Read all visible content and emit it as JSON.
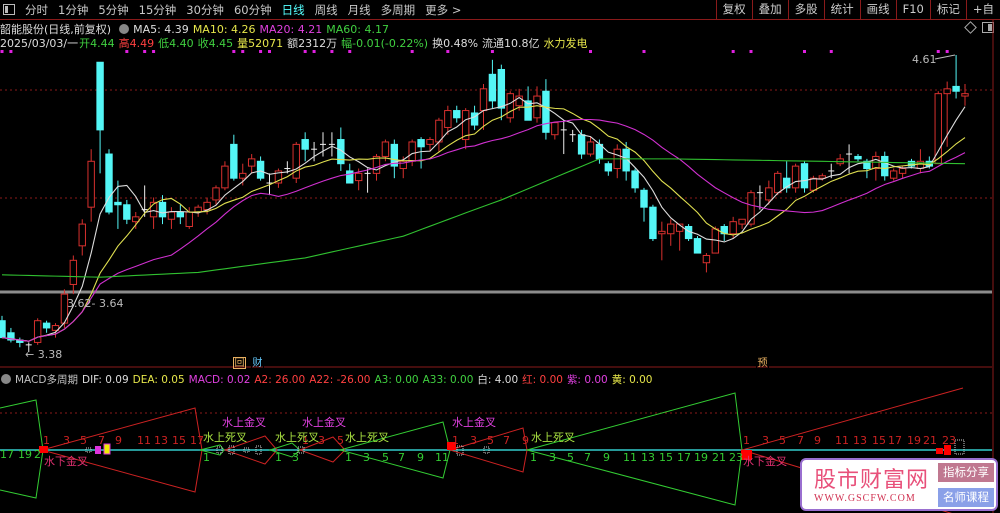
{
  "toolbar": {
    "periods": [
      "分时",
      "1分钟",
      "5分钟",
      "15分钟",
      "30分钟",
      "60分钟",
      "日线",
      "周线",
      "月线",
      "多周期",
      "更多 >"
    ],
    "active_period": "日线",
    "buttons": [
      "复权",
      "叠加",
      "多股",
      "统计",
      "画线",
      "F10",
      "标记",
      "+自"
    ]
  },
  "header": {
    "title": "韶能股份(日线,前复权)",
    "ma5": "MA5: 4.39",
    "ma10": "MA10: 4.26",
    "ma20": "MA20: 4.21",
    "ma60": "MA60: 4.17",
    "date": "2025/03/03/一",
    "open": "开4.44",
    "high": "高4.49",
    "low": "低4.40",
    "close": "收4.45",
    "volume": "量52071",
    "amount": "额2312万",
    "change": "幅-0.01(-0.22%)",
    "turnover": "换0.48%",
    "float": "流通10.8亿",
    "sector": "水力发电"
  },
  "price_labels": {
    "range": "3.62- 3.64",
    "low": "3.38",
    "high": "4.61"
  },
  "event_marks": {
    "hui": "回",
    "cai": "财",
    "yu": "预"
  },
  "macd": {
    "title": "MACD多周期",
    "dif": "DIF: 0.09",
    "dea": "DEA: 0.05",
    "macd": "MACD: 0.02",
    "a2": "A2: 26.00",
    "a22": "A22: -26.00",
    "a3": "A3: 0.00",
    "a33": "A33: 0.00",
    "bai": "白: 4.00",
    "hong": "红: 0.00",
    "zi": "紫: 0.00",
    "huang": "黄: 0.00",
    "signals": {
      "under_gold": "水下金叉",
      "above_dead": "水上死叉",
      "above_gold": "水上金叉"
    },
    "count_rows": [
      [
        "17",
        "19",
        "2"
      ],
      [
        "1",
        "3",
        "5",
        "7",
        "9",
        "11",
        "13",
        "15",
        "17"
      ],
      [
        "1"
      ],
      [
        "1",
        "3"
      ],
      [
        "1",
        "3",
        "5"
      ],
      [
        "1",
        "3",
        "5",
        "7",
        "9",
        "11"
      ],
      [
        "1",
        "3",
        "5",
        "7",
        "9"
      ],
      [
        "1",
        "3",
        "5",
        "7",
        "9",
        "11",
        "13",
        "15",
        "17",
        "19",
        "21",
        "23"
      ],
      [
        "1",
        "3",
        "5",
        "7",
        "9",
        "11",
        "13",
        "15",
        "17",
        "19",
        "21",
        "23"
      ]
    ]
  },
  "watermark": {
    "name": "股市财富网",
    "url": "WWW.GSCFW.COM",
    "tag1": "指标分享",
    "tag2": "名师课程"
  },
  "colors": {
    "up": "#d8302e",
    "down": "#54f6f6",
    "ma5": "#dddddd",
    "ma10": "#e0e050",
    "ma20": "#d030d0",
    "ma60": "#30c030"
  },
  "chart_data": {
    "type": "candlestick",
    "ylim": [
      3.33,
      4.65
    ],
    "candles_ohlc": [
      [
        3.51,
        3.53,
        3.44,
        3.44
      ],
      [
        3.46,
        3.48,
        3.42,
        3.43
      ],
      [
        3.43,
        3.44,
        3.4,
        3.42
      ],
      [
        3.41,
        3.42,
        3.38,
        3.41
      ],
      [
        3.42,
        3.52,
        3.41,
        3.51
      ],
      [
        3.5,
        3.51,
        3.46,
        3.48
      ],
      [
        3.47,
        3.5,
        3.44,
        3.49
      ],
      [
        3.5,
        3.64,
        3.48,
        3.62
      ],
      [
        3.66,
        3.78,
        3.62,
        3.76
      ],
      [
        3.82,
        3.93,
        3.78,
        3.91
      ],
      [
        3.98,
        4.22,
        3.92,
        4.17
      ],
      [
        4.58,
        4.58,
        4.12,
        4.3
      ],
      [
        4.2,
        4.22,
        3.95,
        3.96
      ],
      [
        4.0,
        4.09,
        3.89,
        3.99
      ],
      [
        3.99,
        4.01,
        3.91,
        3.93
      ],
      [
        3.92,
        3.96,
        3.89,
        3.94
      ],
      [
        3.97,
        4.07,
        3.94,
        3.97
      ],
      [
        3.94,
        4.02,
        3.89,
        4.0
      ],
      [
        4.0,
        4.03,
        3.91,
        3.94
      ],
      [
        3.93,
        3.98,
        3.89,
        3.96
      ],
      [
        3.96,
        3.99,
        3.91,
        3.94
      ],
      [
        3.9,
        3.98,
        3.89,
        3.96
      ],
      [
        3.96,
        3.99,
        3.94,
        3.98
      ],
      [
        3.97,
        4.02,
        3.95,
        4.0
      ],
      [
        4.01,
        4.07,
        3.99,
        4.06
      ],
      [
        4.06,
        4.17,
        4.05,
        4.15
      ],
      [
        4.24,
        4.28,
        4.09,
        4.1
      ],
      [
        4.1,
        4.16,
        4.07,
        4.12
      ],
      [
        4.15,
        4.2,
        4.12,
        4.18
      ],
      [
        4.17,
        4.19,
        4.09,
        4.1
      ],
      [
        4.08,
        4.12,
        4.03,
        4.08
      ],
      [
        4.08,
        4.14,
        4.06,
        4.13
      ],
      [
        4.14,
        4.17,
        4.12,
        4.14
      ],
      [
        4.1,
        4.25,
        4.08,
        4.24
      ],
      [
        4.26,
        4.29,
        4.17,
        4.22
      ],
      [
        4.22,
        4.25,
        4.17,
        4.22
      ],
      [
        4.24,
        4.29,
        4.19,
        4.24
      ],
      [
        4.24,
        4.29,
        4.19,
        4.24
      ],
      [
        4.26,
        4.31,
        4.13,
        4.16
      ],
      [
        4.13,
        4.16,
        4.08,
        4.08
      ],
      [
        4.09,
        4.14,
        4.05,
        4.12
      ],
      [
        4.12,
        4.14,
        4.04,
        4.12
      ],
      [
        4.12,
        4.2,
        4.09,
        4.19
      ],
      [
        4.19,
        4.26,
        4.17,
        4.25
      ],
      [
        4.24,
        4.26,
        4.1,
        4.15
      ],
      [
        4.14,
        4.19,
        4.1,
        4.17
      ],
      [
        4.17,
        4.26,
        4.15,
        4.25
      ],
      [
        4.26,
        4.27,
        4.14,
        4.23
      ],
      [
        4.24,
        4.27,
        4.21,
        4.26
      ],
      [
        4.25,
        4.35,
        4.21,
        4.34
      ],
      [
        4.31,
        4.4,
        4.28,
        4.38
      ],
      [
        4.38,
        4.4,
        4.33,
        4.35
      ],
      [
        4.26,
        4.39,
        4.22,
        4.38
      ],
      [
        4.37,
        4.4,
        4.3,
        4.32
      ],
      [
        4.38,
        4.49,
        4.3,
        4.47
      ],
      [
        4.53,
        4.59,
        4.39,
        4.42
      ],
      [
        4.55,
        4.57,
        4.34,
        4.39
      ],
      [
        4.35,
        4.46,
        4.33,
        4.45
      ],
      [
        4.4,
        4.47,
        4.38,
        4.44
      ],
      [
        4.42,
        4.48,
        4.34,
        4.34
      ],
      [
        4.35,
        4.48,
        4.33,
        4.44
      ],
      [
        4.46,
        4.51,
        4.26,
        4.29
      ],
      [
        4.28,
        4.33,
        4.26,
        4.33
      ],
      [
        4.3,
        4.34,
        4.2,
        4.3
      ],
      [
        4.28,
        4.3,
        4.25,
        4.28
      ],
      [
        4.28,
        4.3,
        4.18,
        4.2
      ],
      [
        4.2,
        4.27,
        4.19,
        4.25
      ],
      [
        4.24,
        4.26,
        4.16,
        4.18
      ],
      [
        4.16,
        4.17,
        4.11,
        4.13
      ],
      [
        4.14,
        4.24,
        4.1,
        4.22
      ],
      [
        4.22,
        4.25,
        4.09,
        4.13
      ],
      [
        4.13,
        4.14,
        4.04,
        4.06
      ],
      [
        4.05,
        4.06,
        3.92,
        3.98
      ],
      [
        3.98,
        3.99,
        3.84,
        3.85
      ],
      [
        3.87,
        3.92,
        3.76,
        3.88
      ],
      [
        3.87,
        3.93,
        3.82,
        3.91
      ],
      [
        3.88,
        3.91,
        3.8,
        3.91
      ],
      [
        3.9,
        3.91,
        3.84,
        3.85
      ],
      [
        3.85,
        3.86,
        3.79,
        3.79
      ],
      [
        3.75,
        3.79,
        3.71,
        3.78
      ],
      [
        3.79,
        3.9,
        3.79,
        3.89
      ],
      [
        3.9,
        3.91,
        3.84,
        3.87
      ],
      [
        3.87,
        3.94,
        3.85,
        3.92
      ],
      [
        3.91,
        3.93,
        3.89,
        3.93
      ],
      [
        3.91,
        4.05,
        3.9,
        4.04
      ],
      [
        4.04,
        4.07,
        3.97,
        4.04
      ],
      [
        4.01,
        4.09,
        3.99,
        4.06
      ],
      [
        4.04,
        4.13,
        4.03,
        4.12
      ],
      [
        4.1,
        4.17,
        4.04,
        4.06
      ],
      [
        4.06,
        4.16,
        4.04,
        4.15
      ],
      [
        4.16,
        4.17,
        4.04,
        4.06
      ],
      [
        4.05,
        4.11,
        4.04,
        4.1
      ],
      [
        4.1,
        4.12,
        4.09,
        4.11
      ],
      [
        4.13,
        4.16,
        4.1,
        4.13
      ],
      [
        4.16,
        4.2,
        4.15,
        4.18
      ],
      [
        4.2,
        4.24,
        4.12,
        4.2
      ],
      [
        4.19,
        4.2,
        4.17,
        4.18
      ],
      [
        4.17,
        4.18,
        4.1,
        4.14
      ],
      [
        4.14,
        4.21,
        4.09,
        4.19
      ],
      [
        4.19,
        4.21,
        4.09,
        4.11
      ],
      [
        4.1,
        4.14,
        4.09,
        4.13
      ],
      [
        4.12,
        4.15,
        4.1,
        4.14
      ],
      [
        4.17,
        4.18,
        4.14,
        4.15
      ],
      [
        4.14,
        4.22,
        4.12,
        4.17
      ],
      [
        4.17,
        4.19,
        4.14,
        4.15
      ],
      [
        4.16,
        4.46,
        4.16,
        4.45
      ],
      [
        4.45,
        4.5,
        4.23,
        4.47
      ],
      [
        4.48,
        4.61,
        4.43,
        4.46
      ],
      [
        4.44,
        4.49,
        4.4,
        4.45
      ]
    ],
    "ma60_anchors": [
      [
        0,
        3.7
      ],
      [
        11,
        3.69
      ],
      [
        22,
        3.71
      ],
      [
        34,
        3.77
      ],
      [
        45,
        3.86
      ],
      [
        53,
        3.97
      ],
      [
        56,
        4.01
      ],
      [
        67,
        4.18
      ],
      [
        75,
        4.18
      ],
      [
        108,
        4.16
      ]
    ],
    "marker_candles": [
      0,
      1,
      14,
      16,
      17,
      26,
      27,
      29,
      30,
      34,
      35,
      37,
      39,
      46,
      50,
      55,
      66,
      72,
      82,
      84,
      90,
      93,
      105,
      106
    ]
  }
}
